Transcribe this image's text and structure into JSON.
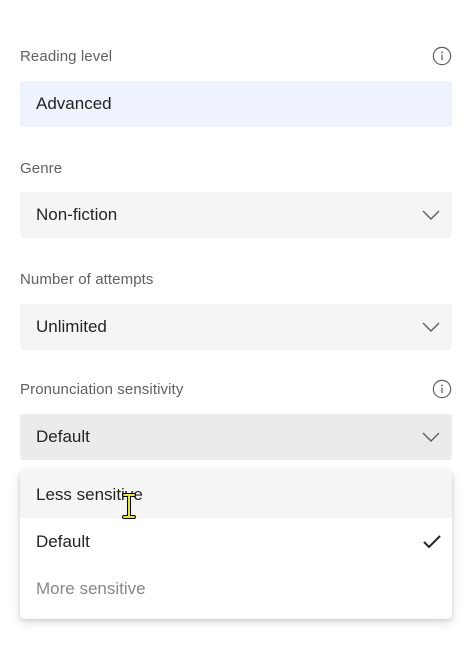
{
  "form": {
    "reading_level": {
      "label": "Reading level",
      "value": "Advanced",
      "info_icon": "info-icon"
    },
    "genre": {
      "label": "Genre",
      "value": "Non-fiction",
      "icon": "chevron-down-icon"
    },
    "attempts": {
      "label": "Number of attempts",
      "value": "Unlimited",
      "icon": "chevron-down-icon"
    },
    "pronunciation": {
      "label": "Pronunciation sensitivity",
      "value": "Default",
      "info_icon": "info-icon",
      "icon": "chevron-down-icon",
      "expanded": true,
      "options": [
        {
          "label": "Less sensitive",
          "hovered": true,
          "selected": false
        },
        {
          "label": "Default",
          "hovered": false,
          "selected": true
        },
        {
          "label": "More sensitive",
          "hovered": false,
          "selected": false
        }
      ]
    }
  },
  "colors": {
    "text_field_bg": "#eef3fe",
    "select_bg": "#f5f5f5",
    "select_open_bg": "#edebe9",
    "label_text": "#616161",
    "muted_text": "#8a8886"
  }
}
